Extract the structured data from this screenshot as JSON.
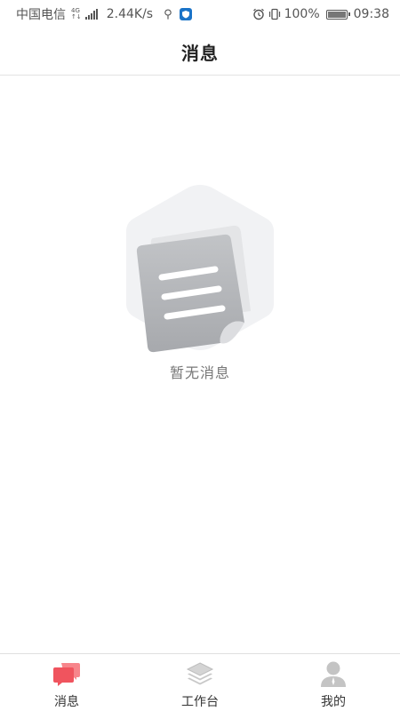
{
  "status_bar": {
    "carrier": "中国电信",
    "network_top": "4G",
    "network_bottom": "↑↓",
    "speed": "2.44K/s",
    "battery_percent": "100%",
    "time": "09:38",
    "battery_level": 1.0
  },
  "header": {
    "title": "消息"
  },
  "empty_state": {
    "text": "暂无消息"
  },
  "tabs": [
    {
      "label": "消息",
      "icon": "chat-bubble-icon",
      "active": true,
      "color": "#f0545e"
    },
    {
      "label": "工作台",
      "icon": "layers-icon",
      "active": false,
      "color": "#bdbdbd"
    },
    {
      "label": "我的",
      "icon": "user-icon",
      "active": false,
      "color": "#bdbdbd"
    }
  ],
  "colors": {
    "accent": "#f0545e",
    "inactive_icon": "#bdbdbd",
    "divider": "#e3e3e3"
  }
}
